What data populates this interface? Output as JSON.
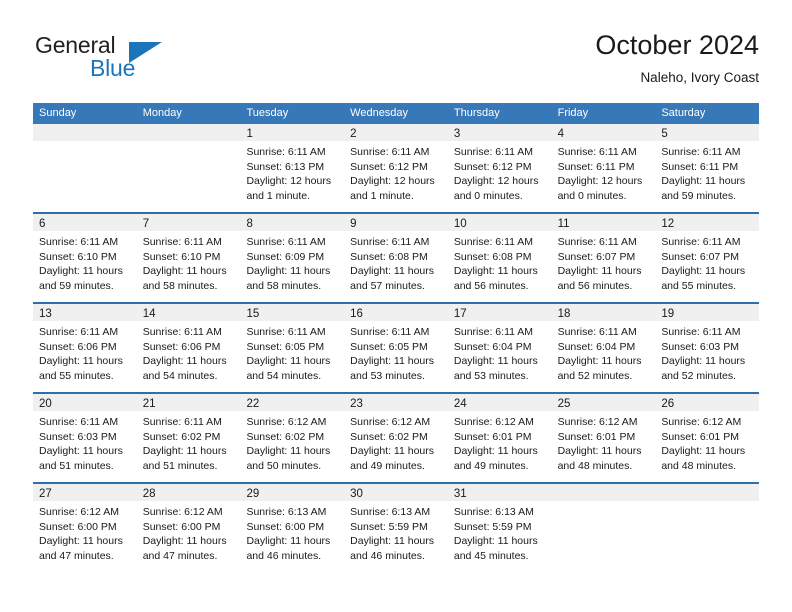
{
  "logo": {
    "word_one": "General",
    "word_two": "Blue",
    "triangle": "triangle-icon",
    "accent": "#1b75bb"
  },
  "header": {
    "title": "October 2024",
    "subtitle": "Naleho, Ivory Coast"
  },
  "colors": {
    "header_blue": "#3778b8",
    "week_divider_blue": "#2f6fab",
    "daynum_band": "#f0f0f0",
    "text": "#1a1a1a"
  },
  "weekdays": [
    "Sunday",
    "Monday",
    "Tuesday",
    "Wednesday",
    "Thursday",
    "Friday",
    "Saturday"
  ],
  "weeks": [
    [
      {
        "day": "",
        "empty": true
      },
      {
        "day": "",
        "empty": true
      },
      {
        "day": "1",
        "sunrise": "Sunrise: 6:11 AM",
        "sunset": "Sunset: 6:13 PM",
        "daylight1": "Daylight: 12 hours",
        "daylight2": "and 1 minute."
      },
      {
        "day": "2",
        "sunrise": "Sunrise: 6:11 AM",
        "sunset": "Sunset: 6:12 PM",
        "daylight1": "Daylight: 12 hours",
        "daylight2": "and 1 minute."
      },
      {
        "day": "3",
        "sunrise": "Sunrise: 6:11 AM",
        "sunset": "Sunset: 6:12 PM",
        "daylight1": "Daylight: 12 hours",
        "daylight2": "and 0 minutes."
      },
      {
        "day": "4",
        "sunrise": "Sunrise: 6:11 AM",
        "sunset": "Sunset: 6:11 PM",
        "daylight1": "Daylight: 12 hours",
        "daylight2": "and 0 minutes."
      },
      {
        "day": "5",
        "sunrise": "Sunrise: 6:11 AM",
        "sunset": "Sunset: 6:11 PM",
        "daylight1": "Daylight: 11 hours",
        "daylight2": "and 59 minutes."
      }
    ],
    [
      {
        "day": "6",
        "sunrise": "Sunrise: 6:11 AM",
        "sunset": "Sunset: 6:10 PM",
        "daylight1": "Daylight: 11 hours",
        "daylight2": "and 59 minutes."
      },
      {
        "day": "7",
        "sunrise": "Sunrise: 6:11 AM",
        "sunset": "Sunset: 6:10 PM",
        "daylight1": "Daylight: 11 hours",
        "daylight2": "and 58 minutes."
      },
      {
        "day": "8",
        "sunrise": "Sunrise: 6:11 AM",
        "sunset": "Sunset: 6:09 PM",
        "daylight1": "Daylight: 11 hours",
        "daylight2": "and 58 minutes."
      },
      {
        "day": "9",
        "sunrise": "Sunrise: 6:11 AM",
        "sunset": "Sunset: 6:08 PM",
        "daylight1": "Daylight: 11 hours",
        "daylight2": "and 57 minutes."
      },
      {
        "day": "10",
        "sunrise": "Sunrise: 6:11 AM",
        "sunset": "Sunset: 6:08 PM",
        "daylight1": "Daylight: 11 hours",
        "daylight2": "and 56 minutes."
      },
      {
        "day": "11",
        "sunrise": "Sunrise: 6:11 AM",
        "sunset": "Sunset: 6:07 PM",
        "daylight1": "Daylight: 11 hours",
        "daylight2": "and 56 minutes."
      },
      {
        "day": "12",
        "sunrise": "Sunrise: 6:11 AM",
        "sunset": "Sunset: 6:07 PM",
        "daylight1": "Daylight: 11 hours",
        "daylight2": "and 55 minutes."
      }
    ],
    [
      {
        "day": "13",
        "sunrise": "Sunrise: 6:11 AM",
        "sunset": "Sunset: 6:06 PM",
        "daylight1": "Daylight: 11 hours",
        "daylight2": "and 55 minutes."
      },
      {
        "day": "14",
        "sunrise": "Sunrise: 6:11 AM",
        "sunset": "Sunset: 6:06 PM",
        "daylight1": "Daylight: 11 hours",
        "daylight2": "and 54 minutes."
      },
      {
        "day": "15",
        "sunrise": "Sunrise: 6:11 AM",
        "sunset": "Sunset: 6:05 PM",
        "daylight1": "Daylight: 11 hours",
        "daylight2": "and 54 minutes."
      },
      {
        "day": "16",
        "sunrise": "Sunrise: 6:11 AM",
        "sunset": "Sunset: 6:05 PM",
        "daylight1": "Daylight: 11 hours",
        "daylight2": "and 53 minutes."
      },
      {
        "day": "17",
        "sunrise": "Sunrise: 6:11 AM",
        "sunset": "Sunset: 6:04 PM",
        "daylight1": "Daylight: 11 hours",
        "daylight2": "and 53 minutes."
      },
      {
        "day": "18",
        "sunrise": "Sunrise: 6:11 AM",
        "sunset": "Sunset: 6:04 PM",
        "daylight1": "Daylight: 11 hours",
        "daylight2": "and 52 minutes."
      },
      {
        "day": "19",
        "sunrise": "Sunrise: 6:11 AM",
        "sunset": "Sunset: 6:03 PM",
        "daylight1": "Daylight: 11 hours",
        "daylight2": "and 52 minutes."
      }
    ],
    [
      {
        "day": "20",
        "sunrise": "Sunrise: 6:11 AM",
        "sunset": "Sunset: 6:03 PM",
        "daylight1": "Daylight: 11 hours",
        "daylight2": "and 51 minutes."
      },
      {
        "day": "21",
        "sunrise": "Sunrise: 6:11 AM",
        "sunset": "Sunset: 6:02 PM",
        "daylight1": "Daylight: 11 hours",
        "daylight2": "and 51 minutes."
      },
      {
        "day": "22",
        "sunrise": "Sunrise: 6:12 AM",
        "sunset": "Sunset: 6:02 PM",
        "daylight1": "Daylight: 11 hours",
        "daylight2": "and 50 minutes."
      },
      {
        "day": "23",
        "sunrise": "Sunrise: 6:12 AM",
        "sunset": "Sunset: 6:02 PM",
        "daylight1": "Daylight: 11 hours",
        "daylight2": "and 49 minutes."
      },
      {
        "day": "24",
        "sunrise": "Sunrise: 6:12 AM",
        "sunset": "Sunset: 6:01 PM",
        "daylight1": "Daylight: 11 hours",
        "daylight2": "and 49 minutes."
      },
      {
        "day": "25",
        "sunrise": "Sunrise: 6:12 AM",
        "sunset": "Sunset: 6:01 PM",
        "daylight1": "Daylight: 11 hours",
        "daylight2": "and 48 minutes."
      },
      {
        "day": "26",
        "sunrise": "Sunrise: 6:12 AM",
        "sunset": "Sunset: 6:01 PM",
        "daylight1": "Daylight: 11 hours",
        "daylight2": "and 48 minutes."
      }
    ],
    [
      {
        "day": "27",
        "sunrise": "Sunrise: 6:12 AM",
        "sunset": "Sunset: 6:00 PM",
        "daylight1": "Daylight: 11 hours",
        "daylight2": "and 47 minutes."
      },
      {
        "day": "28",
        "sunrise": "Sunrise: 6:12 AM",
        "sunset": "Sunset: 6:00 PM",
        "daylight1": "Daylight: 11 hours",
        "daylight2": "and 47 minutes."
      },
      {
        "day": "29",
        "sunrise": "Sunrise: 6:13 AM",
        "sunset": "Sunset: 6:00 PM",
        "daylight1": "Daylight: 11 hours",
        "daylight2": "and 46 minutes."
      },
      {
        "day": "30",
        "sunrise": "Sunrise: 6:13 AM",
        "sunset": "Sunset: 5:59 PM",
        "daylight1": "Daylight: 11 hours",
        "daylight2": "and 46 minutes."
      },
      {
        "day": "31",
        "sunrise": "Sunrise: 6:13 AM",
        "sunset": "Sunset: 5:59 PM",
        "daylight1": "Daylight: 11 hours",
        "daylight2": "and 45 minutes."
      },
      {
        "day": "",
        "empty": true
      },
      {
        "day": "",
        "empty": true
      }
    ]
  ]
}
